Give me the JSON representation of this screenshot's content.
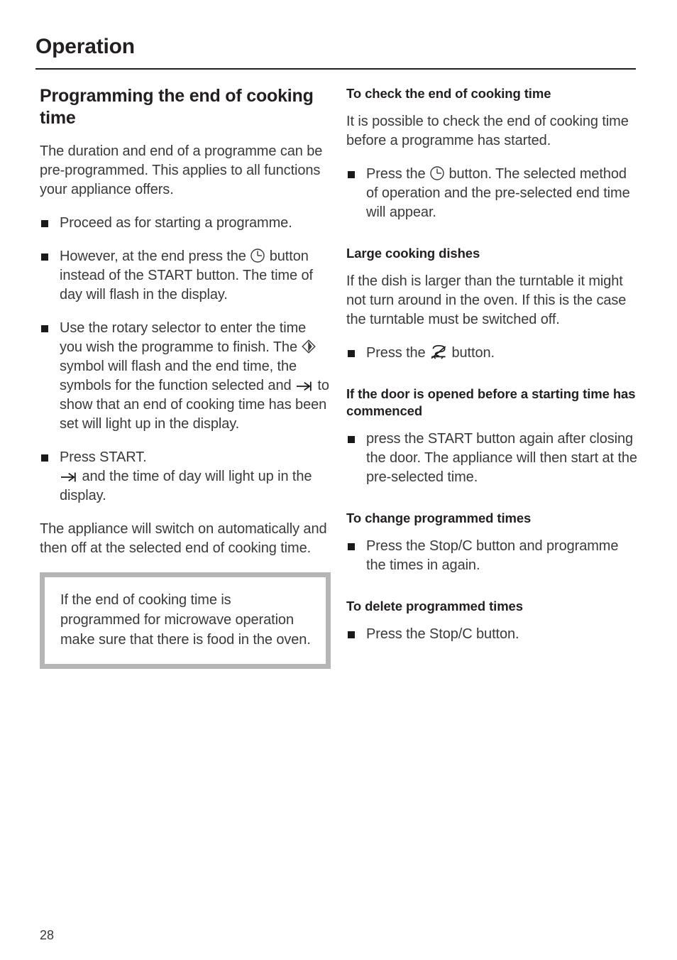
{
  "header": {
    "title": "Operation"
  },
  "left_column": {
    "section_title": "Programming the end of cooking time",
    "intro": "The duration and end of a programme can be pre-programmed. This applies to all functions your appliance offers.",
    "bullets": [
      {
        "text_before": "Proceed as for starting a programme.",
        "icon": null,
        "text_after": ""
      },
      {
        "text_before": "However, at the end press the ",
        "icon": "clock-icon",
        "text_after": " button instead of the START button. The time of day will flash in the display."
      },
      {
        "text_before": "Use the rotary selector to enter the time you wish the programme to finish. The ",
        "icon": "diamond-flash-icon",
        "text_mid": " symbol will flash and the end time, the symbols for the function selected and ",
        "icon2": "arrow-to-bar-icon",
        "text_after": " to show that an end of cooking time has been set will light up in the display."
      },
      {
        "text_before": "Press START.",
        "icon": "arrow-to-bar-icon",
        "text_after": " and the time of day will light up in the display."
      }
    ],
    "closing_para": "The appliance will switch on automatically and then off at the selected end of cooking time.",
    "callout": "If the end of cooking time is programmed for microwave operation make sure that there is food in the oven."
  },
  "right_column": {
    "sections": [
      {
        "heading": "To check the end of cooking time",
        "para": "It is possible to check the end of cooking time before a programme has started.",
        "bullet_before": "Press the ",
        "bullet_icon": "clock-icon",
        "bullet_after": " button. The selected method of operation and the pre-selected end time will appear."
      },
      {
        "heading": "Large cooking dishes",
        "para": "If the dish is larger than the turntable it might not turn around in the oven. If this is the case the turntable must be switched off.",
        "bullet_before": "Press the ",
        "bullet_icon": "turntable-off-icon",
        "bullet_after": " button."
      },
      {
        "heading": "If the door is opened before a starting time has commenced",
        "para": "",
        "bullet_before": "press the START button again after closing the door. The appliance will then start at the pre-selected time.",
        "bullet_icon": null,
        "bullet_after": ""
      },
      {
        "heading": "To change programmed times",
        "para": "",
        "bullet_before": "Press the Stop/C button and programme the times in again.",
        "bullet_icon": null,
        "bullet_after": ""
      },
      {
        "heading": "To delete programmed times",
        "para": "",
        "bullet_before": "Press the Stop/C button.",
        "bullet_icon": null,
        "bullet_after": ""
      }
    ]
  },
  "footer": {
    "page_number": "28"
  },
  "colors": {
    "text": "#231f20",
    "body_text": "#3a3a3a",
    "rule": "#231f20",
    "callout_border": "#b5b5b5"
  }
}
